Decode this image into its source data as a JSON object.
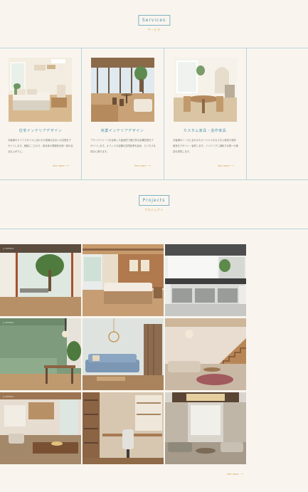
{
  "services": {
    "title": "Services",
    "subtitle": "サービス",
    "cards": [
      {
        "heading": "住宅インテリアデザイン",
        "text": "お客様のライフスタイルに合わせた快適な住まいの空間をデザインします。細部にこだわり、家全体の雰囲気を統一感のある仕上がりに。",
        "more": "See more ⟶",
        "image_icon": "bedroom-photo"
      },
      {
        "heading": "商業インテリアデザイン",
        "text": "ブランドイメージを反映した独創的で魅力的な店舗空間をデザインします。オフィスや店舗の空間効率を高め、ビジネスを成功に導きます。",
        "more": "See more ⟶",
        "image_icon": "cafe-photo"
      },
      {
        "heading": "カスタム家具・造作家具",
        "text": "お客様のニーズに合わせたオリジナルのカスタム家具や造作家具をデザイン・製作します。インテリアに調和する唯一の家具を提供します。",
        "more": "See more ⟶",
        "image_icon": "dining-photo"
      }
    ]
  },
  "projects": {
    "title": "Projects",
    "subtitle": "プロジェクト",
    "watermark": "◎ INTERIA",
    "more": "See more ⟶",
    "tiles": [
      {
        "icon": "courtyard-living-photo"
      },
      {
        "icon": "wood-bedroom-photo"
      },
      {
        "icon": "office-loft-photo"
      },
      {
        "icon": "green-dining-photo"
      },
      {
        "icon": "blue-sofa-photo"
      },
      {
        "icon": "staircase-lounge-photo"
      },
      {
        "icon": "loft-dining-photo"
      },
      {
        "icon": "home-office-photo"
      },
      {
        "icon": "grand-living-photo"
      }
    ]
  },
  "colors": {
    "background": "#f9f5ee",
    "accent_blue": "#4f93ad",
    "accent_gold": "#d4a24e",
    "divider": "#b9d4dc"
  }
}
